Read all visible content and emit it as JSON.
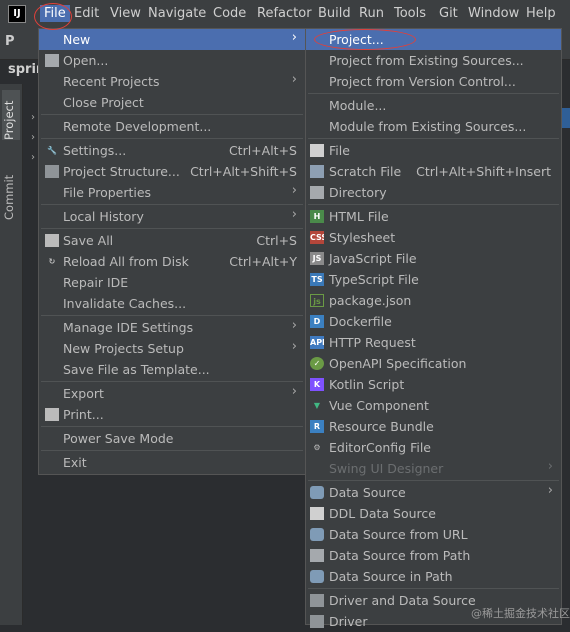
{
  "app_logo": "IJ",
  "menubar": [
    "File",
    "Edit",
    "View",
    "Navigate",
    "Code",
    "Refactor",
    "Build",
    "Run",
    "Tools",
    "Git",
    "Window",
    "Help"
  ],
  "background": {
    "toolbar_label": "P",
    "project_title": "sprir",
    "side_tabs": [
      "Project",
      "Commit"
    ]
  },
  "file_menu": [
    {
      "label": "New",
      "arrow": "›"
    },
    {
      "label": "Open...",
      "icon": "folder-icon"
    },
    {
      "label": "Recent Projects",
      "arrow": "›"
    },
    {
      "label": "Close Project"
    },
    {
      "label": "Remote Development..."
    },
    {
      "label": "Settings...",
      "shortcut": "Ctrl+Alt+S",
      "icon": "wrench-icon"
    },
    {
      "label": "Project Structure...",
      "shortcut": "Ctrl+Alt+Shift+S",
      "icon": "project-structure-icon"
    },
    {
      "label": "File Properties",
      "arrow": "›"
    },
    {
      "label": "Local History",
      "arrow": "›"
    },
    {
      "label": "Save All",
      "shortcut": "Ctrl+S",
      "icon": "save-icon"
    },
    {
      "label": "Reload All from Disk",
      "shortcut": "Ctrl+Alt+Y",
      "icon": "reload-icon"
    },
    {
      "label": "Repair IDE"
    },
    {
      "label": "Invalidate Caches..."
    },
    {
      "label": "Manage IDE Settings",
      "arrow": "›"
    },
    {
      "label": "New Projects Setup",
      "arrow": "›"
    },
    {
      "label": "Save File as Template..."
    },
    {
      "label": "Export",
      "arrow": "›"
    },
    {
      "label": "Print...",
      "icon": "print-icon"
    },
    {
      "label": "Power Save Mode"
    },
    {
      "label": "Exit"
    }
  ],
  "new_submenu": [
    {
      "label": "Project..."
    },
    {
      "label": "Project from Existing Sources..."
    },
    {
      "label": "Project from Version Control..."
    },
    {
      "label": "Module..."
    },
    {
      "label": "Module from Existing Sources..."
    },
    {
      "label": "File",
      "icon": "file-icon"
    },
    {
      "label": "Scratch File",
      "shortcut": "Ctrl+Alt+Shift+Insert",
      "icon": "scratch-file-icon"
    },
    {
      "label": "Directory",
      "icon": "directory-icon"
    },
    {
      "label": "HTML File",
      "icon": "html-file-icon"
    },
    {
      "label": "Stylesheet",
      "icon": "css-file-icon"
    },
    {
      "label": "JavaScript File",
      "icon": "javascript-file-icon"
    },
    {
      "label": "TypeScript File",
      "icon": "typescript-file-icon"
    },
    {
      "label": "package.json",
      "icon": "nodejs-icon"
    },
    {
      "label": "Dockerfile",
      "icon": "docker-icon"
    },
    {
      "label": "HTTP Request",
      "icon": "http-api-icon"
    },
    {
      "label": "OpenAPI Specification",
      "icon": "openapi-icon"
    },
    {
      "label": "Kotlin Script",
      "icon": "kotlin-icon"
    },
    {
      "label": "Vue Component",
      "icon": "vue-icon"
    },
    {
      "label": "Resource Bundle",
      "icon": "resource-bundle-icon"
    },
    {
      "label": "EditorConfig File",
      "icon": "editorconfig-icon"
    },
    {
      "label": "Swing UI Designer",
      "arrow": "›",
      "disabled": true
    },
    {
      "label": "Data Source",
      "arrow": "›",
      "icon": "database-icon"
    },
    {
      "label": "DDL Data Source",
      "icon": "ddl-icon"
    },
    {
      "label": "Data Source from URL",
      "icon": "database-url-icon"
    },
    {
      "label": "Data Source from Path",
      "icon": "folder-db-icon"
    },
    {
      "label": "Data Source in Path",
      "icon": "database-path-icon"
    },
    {
      "label": "Driver and Data Source",
      "icon": "driver-icon"
    },
    {
      "label": "Driver",
      "icon": "driver-icon"
    }
  ],
  "watermark": "@稀土掘金技术社区",
  "colors": {
    "menubar_bg": "#3c3f41",
    "menu_bg": "#3c3f41",
    "selection": "#4b6eaf",
    "annotation": "#e0403a"
  }
}
